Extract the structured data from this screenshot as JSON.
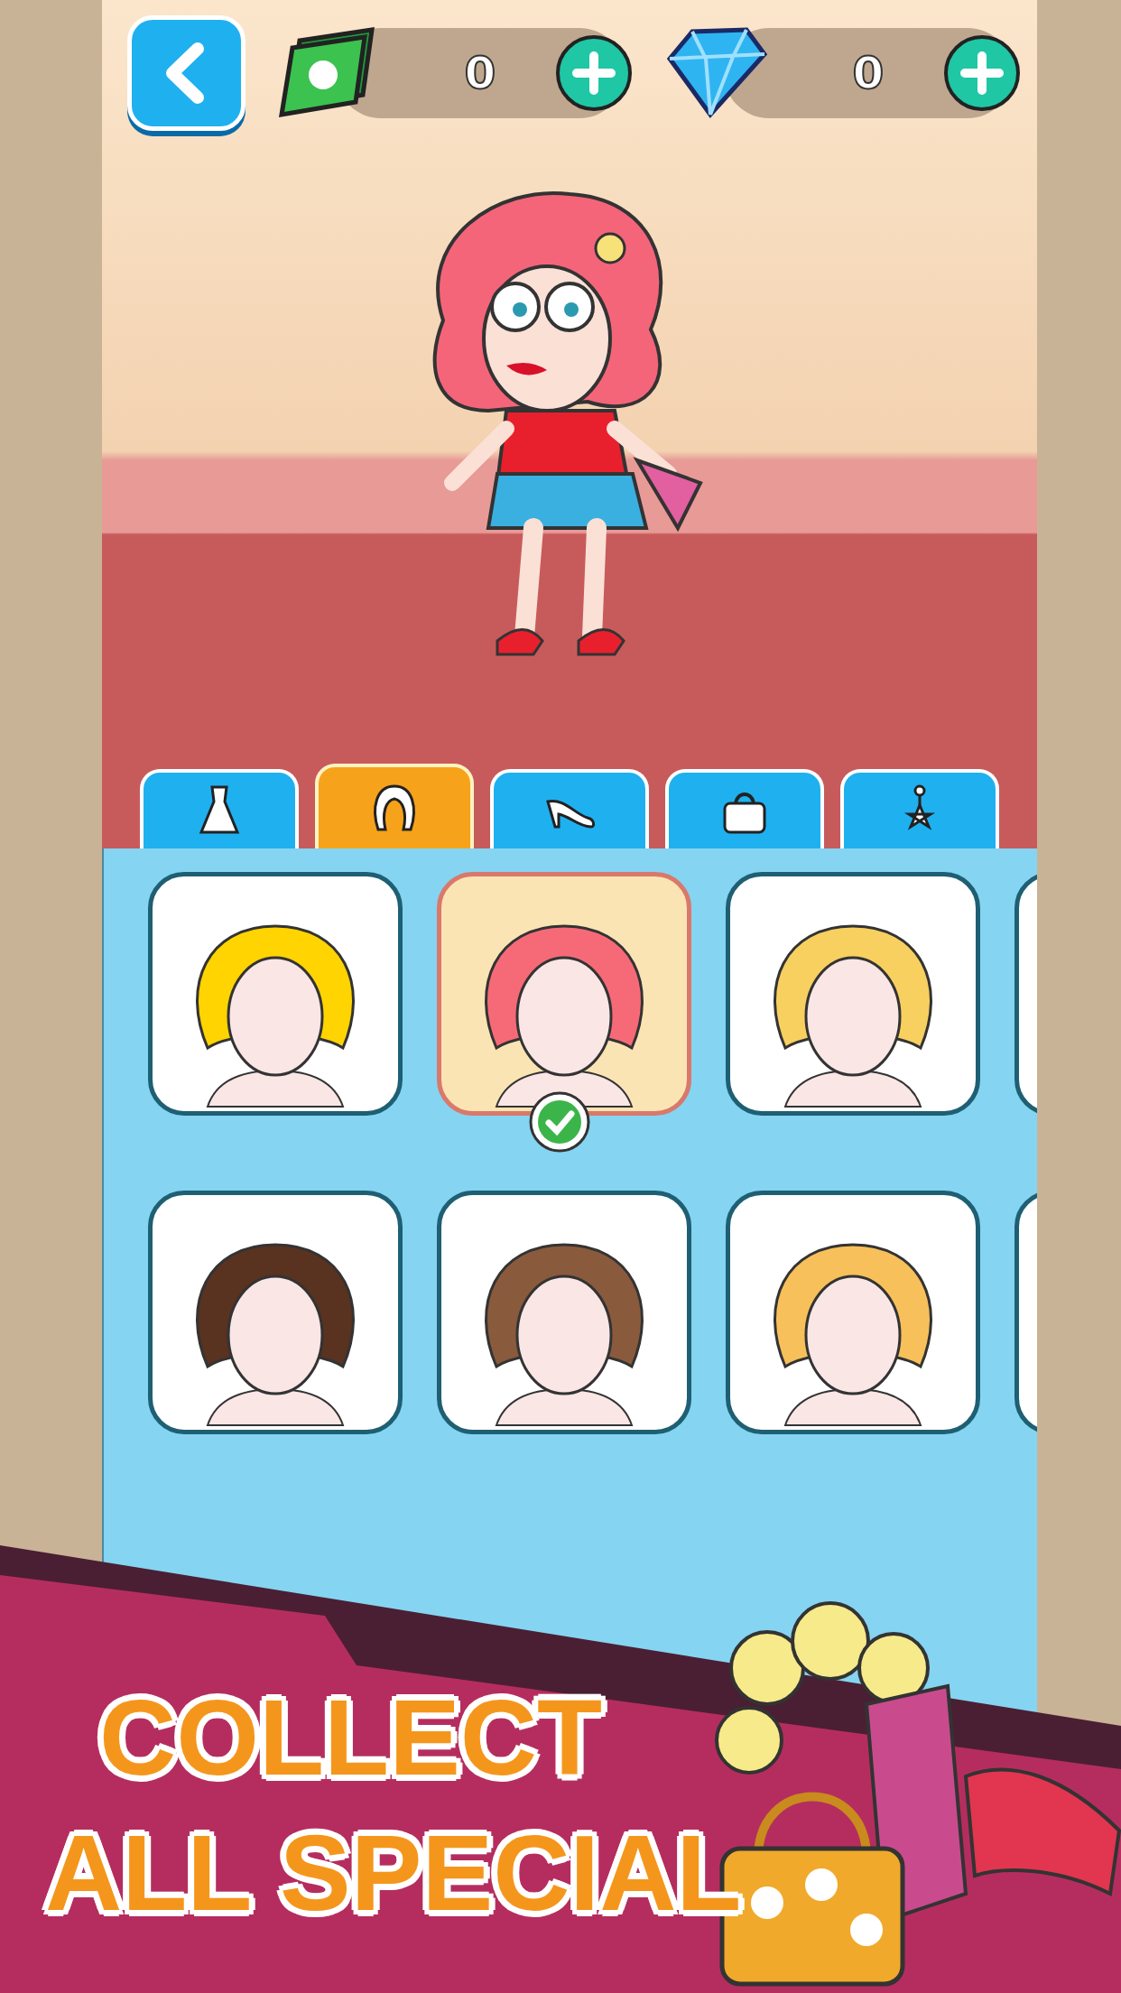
{
  "currencies": [
    {
      "kind": "cash",
      "amount": "0"
    },
    {
      "kind": "gem",
      "amount": "0"
    }
  ],
  "tabs": [
    {
      "kind": "dress",
      "selected": false
    },
    {
      "kind": "hair",
      "selected": true
    },
    {
      "kind": "shoe",
      "selected": false
    },
    {
      "kind": "bag",
      "selected": false
    },
    {
      "kind": "earring",
      "selected": false
    }
  ],
  "items": [
    {
      "color": "#ffd400",
      "selected": false
    },
    {
      "color": "#f66a78",
      "selected": true
    },
    {
      "color": "#f8d060",
      "selected": false
    },
    {
      "selected": false
    },
    {
      "color": "#5a3220",
      "selected": false
    },
    {
      "color": "#8a5a3c",
      "selected": false
    },
    {
      "color": "#f7c05a",
      "selected": false
    },
    {
      "selected": false
    }
  ],
  "banner": {
    "lines": [
      "COLLECT",
      "ALL SPECIAL"
    ]
  }
}
